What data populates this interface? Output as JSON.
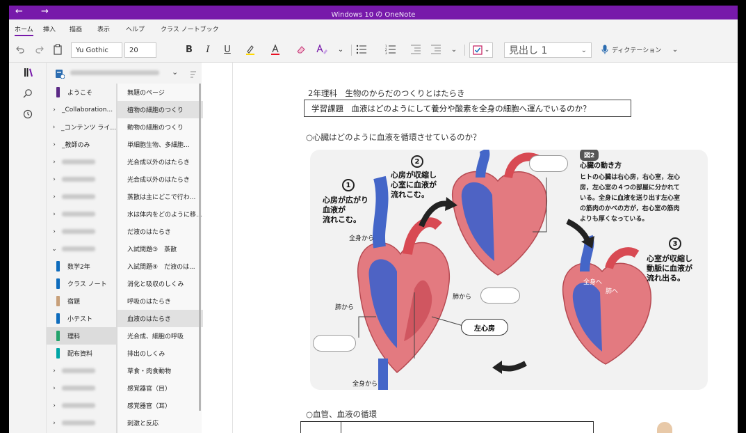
{
  "window": {
    "title": "Windows 10 の OneNote",
    "back": "←",
    "forward": "→"
  },
  "menu": {
    "tabs": [
      "ホーム",
      "挿入",
      "描画",
      "表示",
      "ヘルプ",
      "クラス ノートブック"
    ]
  },
  "toolbar": {
    "font_name": "Yu Gothic",
    "font_size": "20",
    "bold": "B",
    "italic": "I",
    "underline": "U",
    "style": "見出し 1",
    "dictation": "ディクテーション",
    "icons": [
      "undo-icon",
      "redo-icon",
      "clipboard-icon",
      "highlighter-icon",
      "font-color-icon",
      "eraser-icon",
      "text-effects-icon",
      "bullets-icon",
      "numbering-icon",
      "outdent-icon",
      "indent-icon",
      "checkbox-icon",
      "microphone-icon"
    ]
  },
  "sections": [
    {
      "label": "ようこそ",
      "color": "#5b2a86",
      "chevron": ""
    },
    {
      "label": "_Collaboration...",
      "chevron": "›"
    },
    {
      "label": "_コンテンツ ライ...",
      "chevron": "›"
    },
    {
      "label": "_教師のみ",
      "chevron": "›"
    },
    {
      "label": "",
      "chevron": "›"
    },
    {
      "label": "",
      "chevron": "›"
    },
    {
      "label": "",
      "chevron": "›"
    },
    {
      "label": "",
      "chevron": "›"
    },
    {
      "label": "",
      "chevron": "›"
    },
    {
      "label": "",
      "chevron": "⌄"
    },
    {
      "label": "数学2年",
      "color": "#0f6cbd",
      "chevron": ""
    },
    {
      "label": "クラス ノート",
      "color": "#0f6cbd",
      "chevron": ""
    },
    {
      "label": "宿題",
      "color": "#c8a07a",
      "chevron": ""
    },
    {
      "label": "小テスト",
      "color": "#0f6cbd",
      "chevron": ""
    },
    {
      "label": "理科",
      "color": "#24a36b",
      "chevron": "",
      "selected": true
    },
    {
      "label": "配布資料",
      "color": "#00a6a6",
      "chevron": ""
    },
    {
      "label": "",
      "chevron": "›"
    },
    {
      "label": "",
      "chevron": "›"
    },
    {
      "label": "",
      "chevron": "›"
    },
    {
      "label": "",
      "chevron": "›"
    }
  ],
  "pages": [
    {
      "label": "無題のページ"
    },
    {
      "label": "植物の細胞のつくり",
      "selected": true
    },
    {
      "label": "動物の細胞のつくり"
    },
    {
      "label": "単細胞生物、多細胞..."
    },
    {
      "label": "光合成以外のはたらき"
    },
    {
      "label": "光合成以外のはたらき"
    },
    {
      "label": "蒸散は主にどこで行わ..."
    },
    {
      "label": "水は体内をどのように移..."
    },
    {
      "label": "だ液のはたらき"
    },
    {
      "label": "入試問題③　蒸散"
    },
    {
      "label": "入試問題④　だ液のは..."
    },
    {
      "label": "消化と吸収のしくみ"
    },
    {
      "label": "呼吸のはたらき"
    },
    {
      "label": "血液のはたらき",
      "selected": true
    },
    {
      "label": "光合成、細胞の呼吸"
    },
    {
      "label": "排出のしくみ"
    },
    {
      "label": "草食・肉食動物"
    },
    {
      "label": "感覚器官（目）"
    },
    {
      "label": "感覚器官（耳）"
    },
    {
      "label": "刺激と反応"
    }
  ],
  "note": {
    "subject": "2年理科　生物のからだのつくりとはたらき",
    "topic": "学習課題　血液はどのようにして養分や酸素を全身の細胞へ運んでいるのか？",
    "question1": "○心臓はどのように血液を循環させているのか？",
    "question2": "○血管、血液の循環"
  },
  "figure": {
    "badge": "図2",
    "heading": "心臓の動き方",
    "description": [
      "ヒトの心臓は右心房，右心室，左心",
      "房，左心室の４つの部屋に分かれて",
      "いる。全身に血液を送り出す左心室",
      "の筋肉のかべの方が，右心室の筋肉",
      "よりも厚くなっている。"
    ],
    "step1_num": "1",
    "step1": [
      "心房が広がり",
      "血液が",
      "流れこむ。"
    ],
    "step2_num": "2",
    "step2": [
      "心房が収縮し",
      "心室に血液が",
      "流れこむ。"
    ],
    "step3_num": "3",
    "step3": [
      "心室が収縮し",
      "動脈に血液が",
      "流れ出る。"
    ],
    "from_body_top": "全身から",
    "from_lungs_left": "肺から",
    "from_lungs_right": "肺から",
    "from_body_bottom": "全身から",
    "left_atrium": "左心房",
    "to_body": "全身へ",
    "to_lungs": "肺へ"
  }
}
